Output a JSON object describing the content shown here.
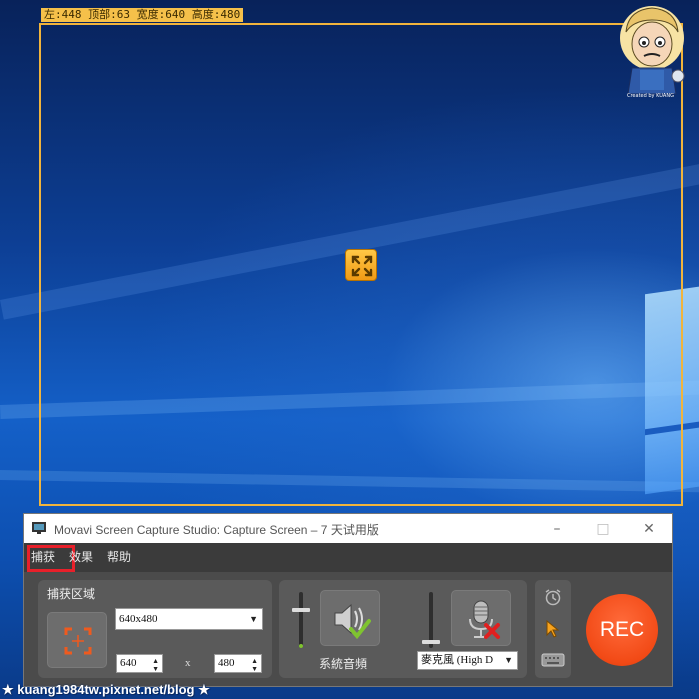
{
  "capture": {
    "coord_label": "左:448 顶部:63 宽度:640 高度:480",
    "expand_icon": "expand-arrows-icon"
  },
  "window": {
    "title": "Movavi Screen Capture Studio: Capture Screen – 7 天试用版",
    "minimize": "–",
    "maximize": "□",
    "close": "✕"
  },
  "menu": {
    "items": [
      "捕获",
      "效果",
      "帮助"
    ]
  },
  "capture_panel": {
    "label": "捕获区域",
    "preset_value": "640x480",
    "width_value": "640",
    "height_value": "480",
    "x_sep": "x"
  },
  "audio": {
    "system_label": "系統音頻",
    "mic_select_value": "麥克風 (High D"
  },
  "rec": {
    "label": "REC"
  },
  "watermark": {
    "text": "★ kuang1984tw.pixnet.net/blog ★"
  },
  "avatar": {
    "caption": "Created by KUANG"
  },
  "colors": {
    "frame": "#f1b43c",
    "rec": "#f24a16",
    "menu_highlight": "#e8202a",
    "check_green": "#7fc330",
    "cross_red": "#e02020"
  }
}
